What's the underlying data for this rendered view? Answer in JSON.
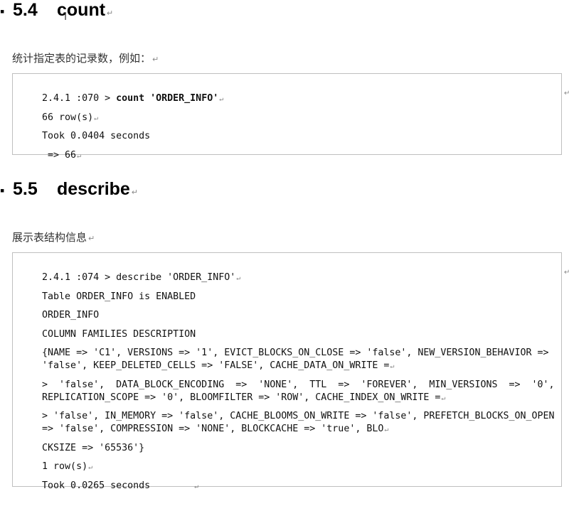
{
  "symbols": {
    "return_mark": "↵",
    "bullet": "▪",
    "cursor": "I"
  },
  "section_count": {
    "number": "5.4",
    "title": "count",
    "intro": "统计指定表的记录数，例如：",
    "code": {
      "line1_prefix": "2.4.1 :070 > ",
      "line1_command": "count 'ORDER_INFO'",
      "line2": "66 row(s)",
      "line3": "Took 0.0404 seconds",
      "line4": " => 66"
    }
  },
  "section_describe": {
    "number": "5.5",
    "title": "describe",
    "intro": "展示表结构信息",
    "code": {
      "line1": "2.4.1 :074 > describe 'ORDER_INFO'",
      "line2": "Table ORDER_INFO is ENABLED",
      "line3": "ORDER_INFO",
      "line4": "COLUMN FAMILIES DESCRIPTION",
      "line5a": "{NAME => 'C1', VERSIONS => '1', EVICT_BLOCKS_ON_CLOSE => 'false', NEW_VERSION_BEHAVIOR =>",
      "line5b": "'false', KEEP_DELETED_CELLS => 'FALSE', CACHE_DATA_ON_WRITE =",
      "line6a": ">  'false',  DATA_BLOCK_ENCODING  =>  'NONE',  TTL  =>  'FOREVER',  MIN_VERSIONS  =>  '0',",
      "line6b": "REPLICATION_SCOPE => '0', BLOOMFILTER => 'ROW', CACHE_INDEX_ON_WRITE =",
      "line7a": "> 'false', IN_MEMORY => 'false', CACHE_BLOOMS_ON_WRITE => 'false', PREFETCH_BLOCKS_ON_OPEN",
      "line7b": "=> 'false', COMPRESSION => 'NONE', BLOCKCACHE => 'true', BLO",
      "line8": "CKSIZE => '65536'}",
      "line9": "1 row(s)",
      "line10": "Took 0.0265 seconds"
    }
  }
}
